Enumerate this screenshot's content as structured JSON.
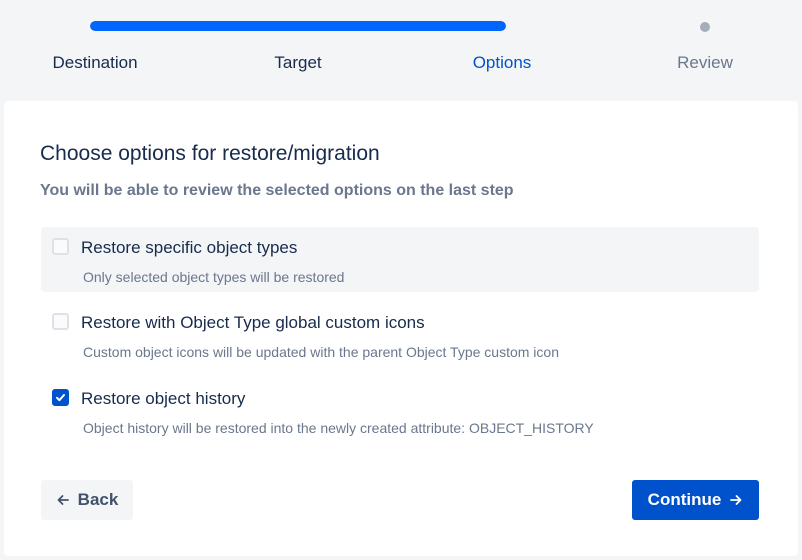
{
  "stepper": {
    "progress_percent": 0.5,
    "steps": [
      {
        "label": "Destination",
        "state": "done"
      },
      {
        "label": "Target",
        "state": "done"
      },
      {
        "label": "Options",
        "state": "current"
      },
      {
        "label": "Review",
        "state": "upcoming"
      }
    ]
  },
  "content": {
    "title": "Choose options for restore/migration",
    "subtitle": "You will be able to review the selected options on the last step",
    "options": [
      {
        "label": "Restore specific object types",
        "description": "Only selected object types will be restored",
        "checked": false
      },
      {
        "label": "Restore with Object Type global custom icons",
        "description": "Custom object icons will be updated with the parent Object Type custom icon",
        "checked": false
      },
      {
        "label": "Restore object history",
        "description": "Object history will be restored into the newly created attribute: OBJECT_HISTORY",
        "checked": true
      }
    ]
  },
  "actions": {
    "back_label": "Back",
    "continue_label": "Continue"
  },
  "colors": {
    "primary": "#0052cc",
    "progress": "#0065ff",
    "text": "#172b4d",
    "muted": "#6b778c"
  }
}
